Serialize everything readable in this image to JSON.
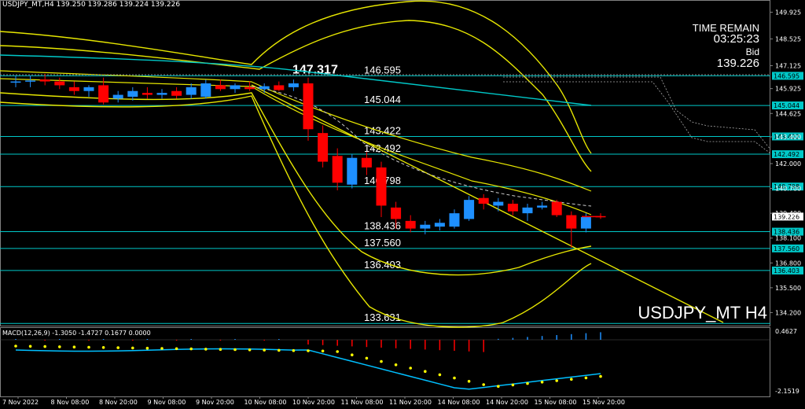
{
  "header": {
    "symbol_info": "USDJPY_MT,H4  139.250 139.286 139.224 139.226"
  },
  "info_panel": {
    "time_label": "TIME REMAIN",
    "time_value": "03:25:23",
    "bid_label": "Bid",
    "bid_value": "139.226"
  },
  "watermark": "USDJPY_MT H4",
  "macd": {
    "label": "MACD(12,26,9) -1.3050 -1.4727 0.1677 0.0000",
    "top_tick": "0.4627",
    "bottom_tick": "-2.1519"
  },
  "colors": {
    "background": "#000000",
    "bull": "#1e90ff",
    "bear": "#ff0000",
    "level": "#00c8c8",
    "bands": "#e6e600",
    "macd_line": "#00bfff",
    "signal_dots": "#ffff00"
  },
  "chart_data": {
    "type": "candlestick",
    "ylim": [
      133.6,
      150.4
    ],
    "y_ticks": [
      "149.925",
      "148.525",
      "147.125",
      "145.925",
      "144.625",
      "143.400",
      "142.000",
      "140.700",
      "139.400",
      "138.100",
      "136.800",
      "135.500",
      "134.200"
    ],
    "x_labels": [
      "7 Nov 2022",
      "8 Nov 08:00",
      "8 Nov 20:00",
      "9 Nov 08:00",
      "9 Nov 20:00",
      "10 Nov 08:00",
      "10 Nov 20:00",
      "11 Nov 08:00",
      "11 Nov 20:00",
      "14 Nov 08:00",
      "14 Nov 20:00",
      "15 Nov 08:00",
      "15 Nov 20:00"
    ],
    "price_levels": [
      {
        "value": 146.595,
        "label": "146.595",
        "tag": "146.595"
      },
      {
        "value": 145.044,
        "label": "145.044",
        "tag": "145.044"
      },
      {
        "value": 143.422,
        "label": "143.422",
        "tag": "143.422"
      },
      {
        "value": 142.492,
        "label": "142.492",
        "tag": "142.492"
      },
      {
        "value": 140.798,
        "label": "140.798",
        "tag": "140.798"
      },
      {
        "value": 138.436,
        "label": "138.436",
        "tag": "138.436"
      },
      {
        "value": 137.56,
        "label": "137.560",
        "tag": "137.560"
      },
      {
        "value": 136.403,
        "label": "136.403",
        "tag": "136.403"
      },
      {
        "value": 133.631,
        "label": "133.631",
        "tag": ""
      }
    ],
    "highlight_label": "147.317",
    "current_price": {
      "value": 139.226,
      "label": "139.226"
    },
    "candles": [
      {
        "o": 146.3,
        "h": 146.6,
        "l": 146.0,
        "c": 146.3
      },
      {
        "o": 146.3,
        "h": 146.6,
        "l": 146.0,
        "c": 146.35
      },
      {
        "o": 146.4,
        "h": 146.7,
        "l": 146.1,
        "c": 146.3
      },
      {
        "o": 146.3,
        "h": 146.5,
        "l": 145.9,
        "c": 146.1
      },
      {
        "o": 146.0,
        "h": 146.3,
        "l": 145.6,
        "c": 145.8
      },
      {
        "o": 145.8,
        "h": 146.1,
        "l": 145.5,
        "c": 146.0
      },
      {
        "o": 146.1,
        "h": 146.5,
        "l": 145.1,
        "c": 145.2
      },
      {
        "o": 145.4,
        "h": 145.8,
        "l": 145.2,
        "c": 145.6
      },
      {
        "o": 145.5,
        "h": 146.0,
        "l": 145.3,
        "c": 145.8
      },
      {
        "o": 145.7,
        "h": 146.0,
        "l": 145.4,
        "c": 145.6
      },
      {
        "o": 145.6,
        "h": 145.9,
        "l": 145.4,
        "c": 145.7
      },
      {
        "o": 145.8,
        "h": 146.0,
        "l": 145.4,
        "c": 145.55
      },
      {
        "o": 145.6,
        "h": 146.2,
        "l": 145.4,
        "c": 146.0
      },
      {
        "o": 145.5,
        "h": 146.4,
        "l": 145.4,
        "c": 146.2
      },
      {
        "o": 146.1,
        "h": 146.4,
        "l": 145.8,
        "c": 145.9
      },
      {
        "o": 145.9,
        "h": 146.2,
        "l": 145.7,
        "c": 146.1
      },
      {
        "o": 146.0,
        "h": 146.3,
        "l": 145.8,
        "c": 145.9
      },
      {
        "o": 145.9,
        "h": 146.2,
        "l": 145.7,
        "c": 146.05
      },
      {
        "o": 146.1,
        "h": 146.3,
        "l": 145.8,
        "c": 145.85
      },
      {
        "o": 146.0,
        "h": 146.4,
        "l": 145.8,
        "c": 146.2
      },
      {
        "o": 146.2,
        "h": 146.5,
        "l": 143.2,
        "c": 143.8
      },
      {
        "o": 143.6,
        "h": 144.0,
        "l": 141.8,
        "c": 142.1
      },
      {
        "o": 142.4,
        "h": 142.8,
        "l": 140.6,
        "c": 141.0
      },
      {
        "o": 140.9,
        "h": 142.5,
        "l": 140.7,
        "c": 142.3
      },
      {
        "o": 142.3,
        "h": 142.6,
        "l": 141.4,
        "c": 141.8
      },
      {
        "o": 141.8,
        "h": 142.1,
        "l": 139.2,
        "c": 139.8
      },
      {
        "o": 139.7,
        "h": 140.0,
        "l": 138.6,
        "c": 139.1
      },
      {
        "o": 139.0,
        "h": 139.3,
        "l": 138.4,
        "c": 138.6
      },
      {
        "o": 138.6,
        "h": 139.0,
        "l": 138.3,
        "c": 138.8
      },
      {
        "o": 138.7,
        "h": 139.1,
        "l": 138.5,
        "c": 138.9
      },
      {
        "o": 138.7,
        "h": 139.6,
        "l": 138.6,
        "c": 139.4
      },
      {
        "o": 139.1,
        "h": 140.3,
        "l": 139.0,
        "c": 140.1
      },
      {
        "o": 140.2,
        "h": 140.4,
        "l": 139.6,
        "c": 139.9
      },
      {
        "o": 139.8,
        "h": 140.2,
        "l": 139.5,
        "c": 140.0
      },
      {
        "o": 139.9,
        "h": 140.1,
        "l": 139.3,
        "c": 139.5
      },
      {
        "o": 139.4,
        "h": 139.9,
        "l": 139.0,
        "c": 139.7
      },
      {
        "o": 139.7,
        "h": 140.0,
        "l": 139.6,
        "c": 139.8
      },
      {
        "o": 140.0,
        "h": 140.1,
        "l": 139.2,
        "c": 139.3
      },
      {
        "o": 139.3,
        "h": 139.5,
        "l": 137.6,
        "c": 138.6
      },
      {
        "o": 138.6,
        "h": 139.4,
        "l": 138.4,
        "c": 139.2
      },
      {
        "o": 139.25,
        "h": 139.4,
        "l": 139.1,
        "c": 139.23
      }
    ]
  }
}
